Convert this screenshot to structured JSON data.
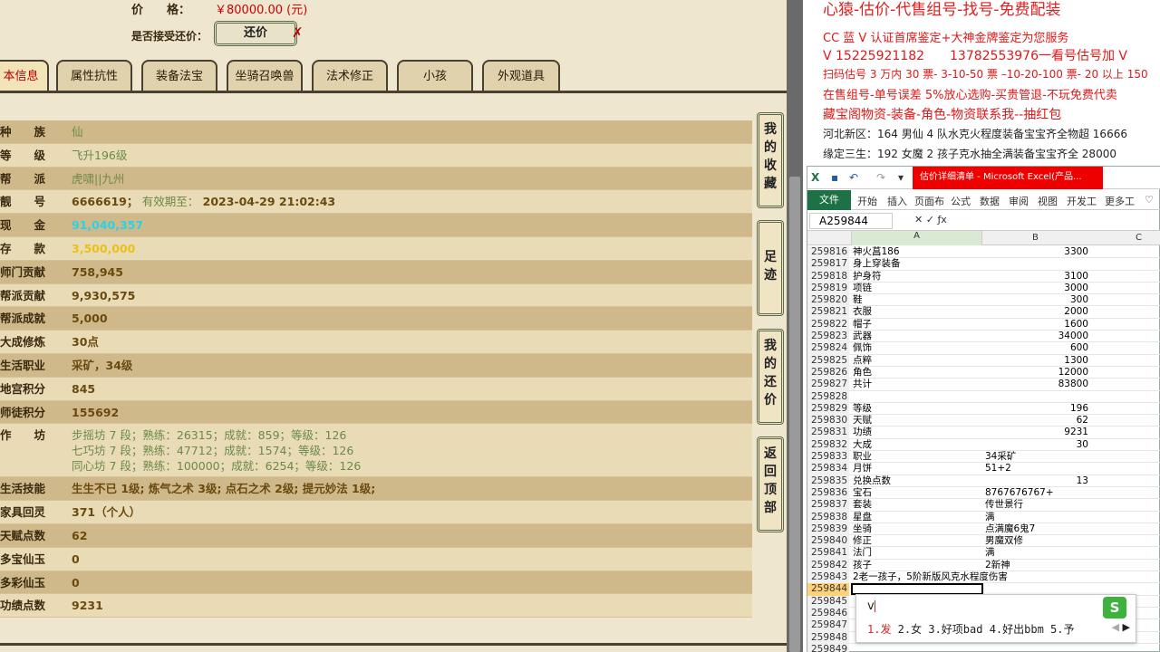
{
  "game": {
    "price_label": "价　　格：",
    "price_value": "￥80000.00 (元)",
    "bargain_label": "是否接受还价：",
    "bargain_button": "还价",
    "tabs": [
      "本信息",
      "属性抗性",
      "装备法宝",
      "坐骑召唤兽",
      "法术修正",
      "小孩",
      "外观道具"
    ],
    "rows": [
      {
        "label": "种　　族",
        "value": "仙",
        "style": "green"
      },
      {
        "label": "等　　级",
        "value": "飞升196级",
        "style": "green"
      },
      {
        "label": "帮　　派",
        "value": "虎啸||九州",
        "style": "green"
      },
      {
        "label": "靓　　号",
        "value": "6666619",
        "extra_label": "有效期至：",
        "extra_value": "2023-04-29 21:02:43"
      },
      {
        "label": "现　　金",
        "value": "91,040,357",
        "style": "cyan"
      },
      {
        "label": "存　　款",
        "value": "3,500,000",
        "style": "yellow"
      },
      {
        "label": "师门贡献",
        "value": "758,945"
      },
      {
        "label": "帮派贡献",
        "value": "9,930,575"
      },
      {
        "label": "帮派成就",
        "value": "5,000"
      },
      {
        "label": "大成修炼",
        "value": "30点"
      },
      {
        "label": "生活职业",
        "value": "采矿，34级"
      },
      {
        "label": "地宫积分",
        "value": "845"
      },
      {
        "label": "师徒积分",
        "value": "155692"
      }
    ],
    "workshop": {
      "label": "作　　坊",
      "lines": [
        "步摇坊 7 段；熟练：26315；成就：859；等级：126",
        "七巧坊 7 段；熟练：47712；成就：1574；等级：126",
        "同心坊 7 段；熟练：100000；成就：6254；等级：126"
      ]
    },
    "rows2": [
      {
        "label": "生活技能",
        "value": "生生不已 1级; 炼气之术 3级; 点石之术 2级; 提元妙法 1级;"
      },
      {
        "label": "家具回灵",
        "value": "371（个人）"
      },
      {
        "label": "天赋点数",
        "value": "62"
      },
      {
        "label": "多宝仙玉",
        "value": "0"
      },
      {
        "label": "多彩仙玉",
        "value": "0"
      },
      {
        "label": "功绩点数",
        "value": "9231"
      }
    ],
    "side_buttons": [
      "我的收藏",
      "足迹",
      "我的还价",
      "返回顶部"
    ]
  },
  "promo": {
    "headline": "心猿-估价-代售组号-找号-免费配装",
    "lines": [
      "CC 蓝 V 认证首席鉴定+大神金牌鉴定为您服务",
      "V 15225921182　　13782553976一看号估号加 V",
      "扫码估号 3 万内 30 票- 3-10-50 票 –10-20-100 票- 20 以上 150",
      "在售组号-单号误差 5%放心选购-买贵管退-不玩免费代卖",
      "藏宝阁物资-装备-角色-物资联系我--抽红包"
    ],
    "black_lines": [
      "河北新区：164 男仙 4 队水克火程度装备宝宝齐全物超 16666",
      "缘定三生：192 女魔 2 孩子克水抽全满装备宝宝齐全 28000"
    ]
  },
  "excel": {
    "title": "估价详细清单 - Microsoft Excel(产品...",
    "ribbon_tabs": [
      "文件",
      "开始",
      "插入",
      "页面布",
      "公式",
      "数据",
      "审阅",
      "视图",
      "开发工",
      "更多工"
    ],
    "name_box": "A259844",
    "col_headers": [
      "A",
      "B",
      "C"
    ],
    "rows": [
      {
        "n": "259816",
        "a": "神火菖186",
        "b": "3300",
        "num": true
      },
      {
        "n": "259817",
        "a": "身上穿装备",
        "b": ""
      },
      {
        "n": "259818",
        "a": "护身符",
        "b": "3100",
        "num": true
      },
      {
        "n": "259819",
        "a": "项链",
        "b": "3000",
        "num": true
      },
      {
        "n": "259820",
        "a": "鞋",
        "b": "300",
        "num": true
      },
      {
        "n": "259821",
        "a": "衣服",
        "b": "2000",
        "num": true
      },
      {
        "n": "259822",
        "a": "帽子",
        "b": "1600",
        "num": true
      },
      {
        "n": "259823",
        "a": "武器",
        "b": "34000",
        "num": true
      },
      {
        "n": "259824",
        "a": "佩饰",
        "b": "600",
        "num": true
      },
      {
        "n": "259825",
        "a": "点粹",
        "b": "1300",
        "num": true
      },
      {
        "n": "259826",
        "a": "角色",
        "b": "12000",
        "num": true
      },
      {
        "n": "259827",
        "a": "共计",
        "b": "83800",
        "num": true
      },
      {
        "n": "259828",
        "a": "",
        "b": ""
      },
      {
        "n": "259829",
        "a": "等级",
        "b": "196",
        "num": true
      },
      {
        "n": "259830",
        "a": "天赋",
        "b": "62",
        "num": true
      },
      {
        "n": "259831",
        "a": "功绩",
        "b": "9231",
        "num": true
      },
      {
        "n": "259832",
        "a": "大成",
        "b": "30",
        "num": true
      },
      {
        "n": "259833",
        "a": "职业",
        "b": "34采矿"
      },
      {
        "n": "259834",
        "a": "月饼",
        "b": "51+2"
      },
      {
        "n": "259835",
        "a": "兑换点数",
        "b": "13",
        "num": true
      },
      {
        "n": "259836",
        "a": "宝石",
        "b": "8767676767+"
      },
      {
        "n": "259837",
        "a": "套装",
        "b": "传世景行"
      },
      {
        "n": "259838",
        "a": "星盘",
        "b": "满"
      },
      {
        "n": "259839",
        "a": "坐骑",
        "b": "点满魔6鬼7"
      },
      {
        "n": "259840",
        "a": "修正",
        "b": "男魔双修"
      },
      {
        "n": "259841",
        "a": "法门",
        "b": "满"
      },
      {
        "n": "259842",
        "a": "孩子",
        "b": "2新神"
      },
      {
        "n": "259843",
        "a": "2老一孩子，5阶新版风克水程度伤害",
        "b": ""
      },
      {
        "n": "259844",
        "a": "",
        "b": "",
        "selected": true
      },
      {
        "n": "259845",
        "a": "",
        "b": ""
      },
      {
        "n": "259846",
        "a": "",
        "b": ""
      },
      {
        "n": "259847",
        "a": "",
        "b": ""
      },
      {
        "n": "259848",
        "a": "",
        "b": ""
      },
      {
        "n": "259849",
        "a": "",
        "b": ""
      }
    ]
  },
  "ime": {
    "composition": "v",
    "candidates_first": "1.发",
    "candidates_rest": " 2.女 3.好项bad 4.好出bbm 5.予"
  }
}
